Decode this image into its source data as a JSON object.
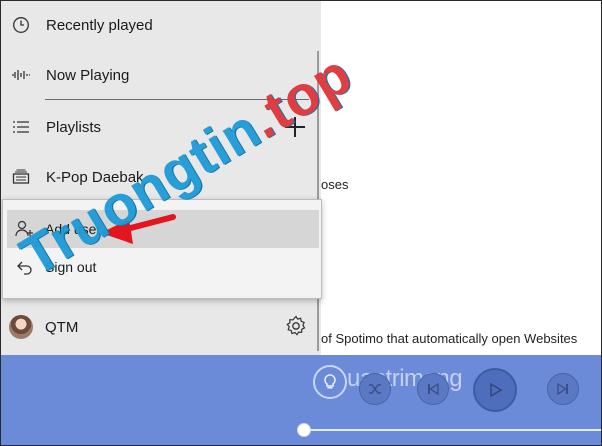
{
  "sidebar": {
    "items": [
      {
        "label": "Recently played",
        "icon": "clock-icon"
      },
      {
        "label": "Now Playing",
        "icon": "equalizer-icon"
      },
      {
        "label": "Playlists",
        "icon": "list-icon"
      },
      {
        "label": "K-Pop Daebak",
        "icon": "playlist-icon"
      }
    ],
    "add_playlist_icon": "plus-icon"
  },
  "popup": {
    "items": [
      {
        "label": "Add user",
        "icon": "add-user-icon"
      },
      {
        "label": "Sign out",
        "icon": "sign-out-icon"
      }
    ]
  },
  "user": {
    "name": "QTM",
    "settings_icon": "gear-icon"
  },
  "main": {
    "text_1": "oses",
    "text_2": "of Spotimo that automatically open Websites"
  },
  "player": {
    "controls": [
      "shuffle-icon",
      "previous-icon",
      "play-icon",
      "next-icon"
    ]
  },
  "watermarks": {
    "primary_1": "Truongtin",
    "primary_2": ".top",
    "secondary": "uantrimang"
  },
  "colors": {
    "sidebar_bg": "#e8e8e8",
    "player_bg": "#6b8bd8",
    "arrow": "#e3161d",
    "watermark_blue": "#1e9bd8",
    "watermark_red": "#e0343a"
  }
}
